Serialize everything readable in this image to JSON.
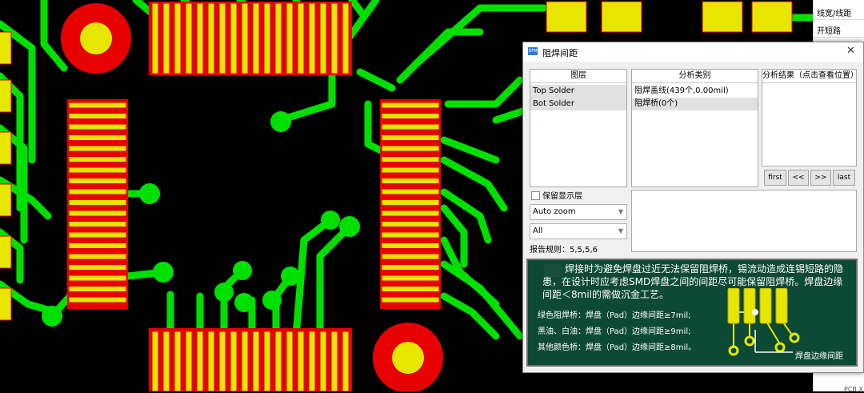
{
  "side_panel": {
    "items": [
      "线宽/线距",
      "开短路"
    ],
    "bottom_tag": "PCB X"
  },
  "dialog": {
    "app_icon": "DFM",
    "title": "阻焊间距",
    "close_icon": "close-icon",
    "layers": {
      "header": "图层",
      "items": [
        {
          "label": "Top Solder",
          "selected": true
        },
        {
          "label": "Bot Solder",
          "selected": true
        }
      ]
    },
    "categories": {
      "header": "分析类别",
      "items": [
        {
          "label": "阻焊盖线(439个,0.00mil)",
          "selected": false
        },
        {
          "label": "阻焊桥(0个)",
          "selected": true
        }
      ]
    },
    "results": {
      "header": "分析结果（点击查看位置）"
    },
    "nav_buttons": [
      "first",
      "<<",
      ">>",
      "last"
    ],
    "keep_display_layer": {
      "label": "保留显示层",
      "checked": false
    },
    "zoom_select": {
      "value": "Auto zoom"
    },
    "filter_select": {
      "value": "All"
    },
    "report_rule": "报告规则：5,5,5,6",
    "note": {
      "paragraph": "焊接时为避免焊盘过近无法保留阻焊桥，锡流动造成连锡短路的隐患，在设计时应考虑SMD焊盘之间的间距尽可能保留阻焊桥。焊盘边缘间距＜8mil的需做沉金工艺。",
      "lines": [
        "绿色阻焊桥：焊盘（Pad）边缘间距≥7mil;",
        "黑油、白油：焊盘（Pad）边缘间距≥9mil;",
        "其他颜色桥：焊盘（Pad）边缘间距≥8mil。"
      ],
      "figure_label": "焊盘边缘间距"
    }
  },
  "colors": {
    "board": "#000000",
    "trace": "#00e000",
    "pad_fill": "#e6e600",
    "pad_edge": "#e60000",
    "note_bg": "#0d4a35"
  }
}
